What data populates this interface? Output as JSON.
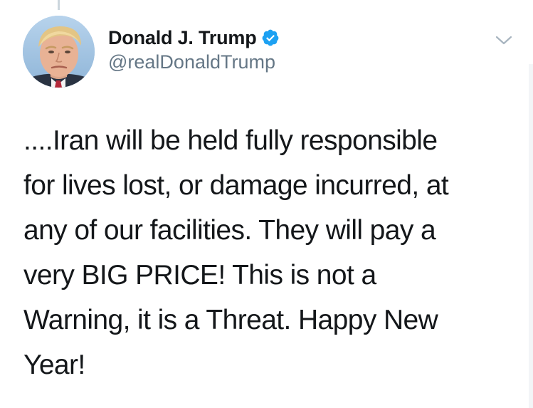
{
  "tweet": {
    "author": {
      "display_name": "Donald J. Trump",
      "handle": "@realDonaldTrump",
      "verified": true
    },
    "text_lines": [
      "....Iran will be held fully responsible",
      "for lives lost, or damage incurred, at",
      "any of our facilities. They will pay a",
      "very BIG PRICE! This is not a",
      "Warning, it is a Threat. Happy New",
      "Year!"
    ]
  },
  "colors": {
    "text": "#14171a",
    "secondary_text": "#657786",
    "verified_blue": "#1da1f2",
    "thread_line": "#ccd6dd"
  },
  "icons": {
    "verified": "verified-badge-icon",
    "menu": "chevron-down-icon"
  }
}
